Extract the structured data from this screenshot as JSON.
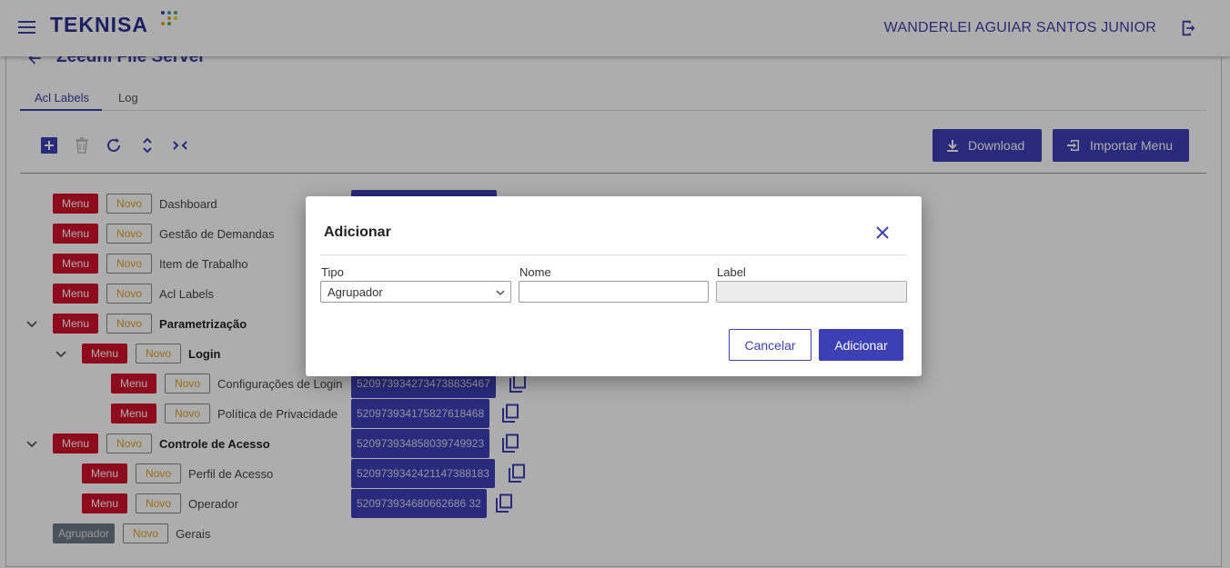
{
  "header": {
    "logo": "TEKNISA",
    "user_name": "WANDERLEI AGUIAR SANTOS JUNIOR"
  },
  "page": {
    "title": "Zeedhi File Server",
    "tabs": [
      {
        "label": "Acl Labels",
        "active": true
      },
      {
        "label": "Log",
        "active": false
      }
    ]
  },
  "toolbar": {
    "download_label": "Download",
    "import_label": "Importar Menu"
  },
  "tree": {
    "rows": [
      {
        "type": "Menu",
        "novo": "Novo",
        "label": "Dashboard",
        "id": ""
      },
      {
        "type": "Menu",
        "novo": "Novo",
        "label": "Gestão de Demandas",
        "id": ""
      },
      {
        "type": "Menu",
        "novo": "Novo",
        "label": "Item de Trabalho",
        "id": ""
      },
      {
        "type": "Menu",
        "novo": "Novo",
        "label": "Acl Labels",
        "id": ""
      },
      {
        "type": "Menu",
        "novo": "Novo",
        "label": "Parametrização",
        "id": ""
      },
      {
        "type": "Menu",
        "novo": "Novo",
        "label": "Login",
        "id": ""
      },
      {
        "type": "Menu",
        "novo": "Novo",
        "label": "Configurações de Login",
        "id": "520973934273473883 5467"
      },
      {
        "type": "Menu",
        "novo": "Novo",
        "label": "Política de Privacidade",
        "id": "5209739341758276184 68"
      },
      {
        "type": "Menu",
        "novo": "Novo",
        "label": "Controle de Acesso",
        "id": "520973934858039749923"
      },
      {
        "type": "Menu",
        "novo": "Novo",
        "label": "Perfil de Acesso",
        "id": "5209739342421147388183"
      },
      {
        "type": "Menu",
        "novo": "Novo",
        "label": "Operador",
        "id": "520973934680662686 32"
      },
      {
        "type": "Agrupador",
        "novo": "Novo",
        "label": "Gerais",
        "id": ""
      }
    ],
    "ids": {
      "config_login": "5209739342734738835467",
      "politica": "520973934175827618468",
      "controle": "520973934858039749923",
      "perfil": "5209739342421147388183",
      "operador": "520973934680662686 32"
    }
  },
  "dialog": {
    "title": "Adicionar",
    "tipo_label": "Tipo",
    "tipo_value": "Agrupador",
    "nome_label": "Nome",
    "nome_value": "",
    "label_label": "Label",
    "label_value": "",
    "cancel_label": "Cancelar",
    "submit_label": "Adicionar"
  },
  "colors": {
    "primary": "#3d3fb5",
    "menu_chip": "#d0112b",
    "agrupador_chip": "#6c7a86",
    "novo_text": "#e6a020"
  }
}
